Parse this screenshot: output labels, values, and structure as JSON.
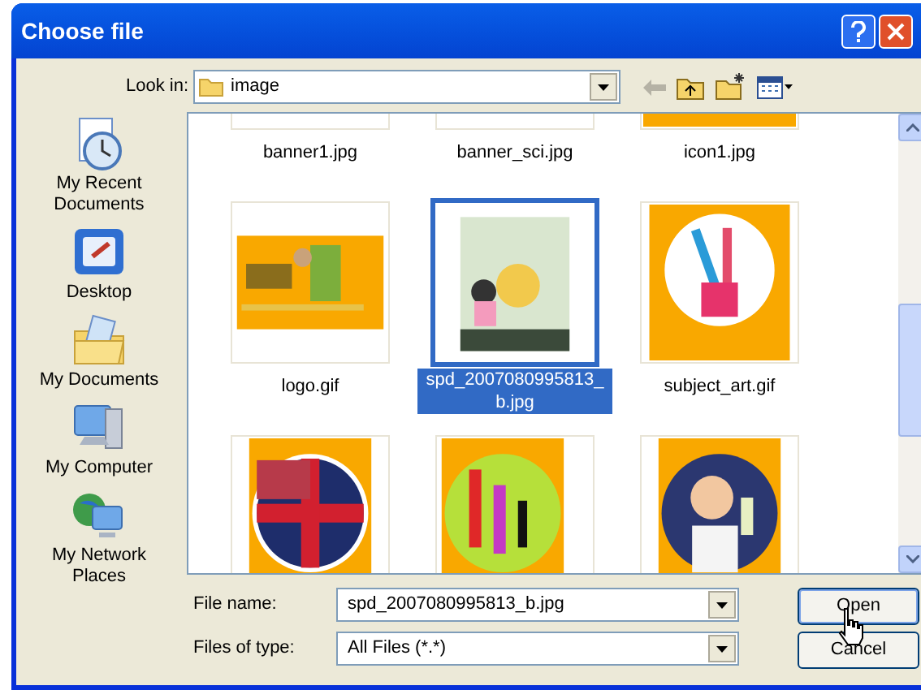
{
  "window": {
    "title": "Choose file"
  },
  "look_in": {
    "label": "Look in:",
    "value": "image"
  },
  "places": [
    {
      "label": "My Recent Documents",
      "kind": "recent"
    },
    {
      "label": "Desktop",
      "kind": "desktop"
    },
    {
      "label": "My Documents",
      "kind": "documents"
    },
    {
      "label": "My Computer",
      "kind": "computer"
    },
    {
      "label": "My Network Places",
      "kind": "network"
    }
  ],
  "files": [
    {
      "name": "banner1.jpg",
      "selected": false,
      "kind": "picture"
    },
    {
      "name": "banner_sci.jpg",
      "selected": false,
      "kind": "picture"
    },
    {
      "name": "icon1.jpg",
      "selected": false,
      "kind": "picture"
    },
    {
      "name": "logo.gif",
      "selected": false,
      "kind": "picture"
    },
    {
      "name": "spd_2007080995813_b.jpg",
      "selected": true,
      "kind": "picture"
    },
    {
      "name": "subject_art.gif",
      "selected": false,
      "kind": "picture"
    },
    {
      "selected": false,
      "kind": "picture"
    },
    {
      "selected": false,
      "kind": "picture"
    },
    {
      "selected": false,
      "kind": "picture"
    }
  ],
  "file_name": {
    "label": "File name:",
    "value": "spd_2007080995813_b.jpg"
  },
  "file_type": {
    "label": "Files of type:",
    "value": "All Files (*.*)"
  },
  "buttons": [
    {
      "label": "Open",
      "focused": true
    },
    {
      "label": "Cancel",
      "focused": false
    }
  ]
}
